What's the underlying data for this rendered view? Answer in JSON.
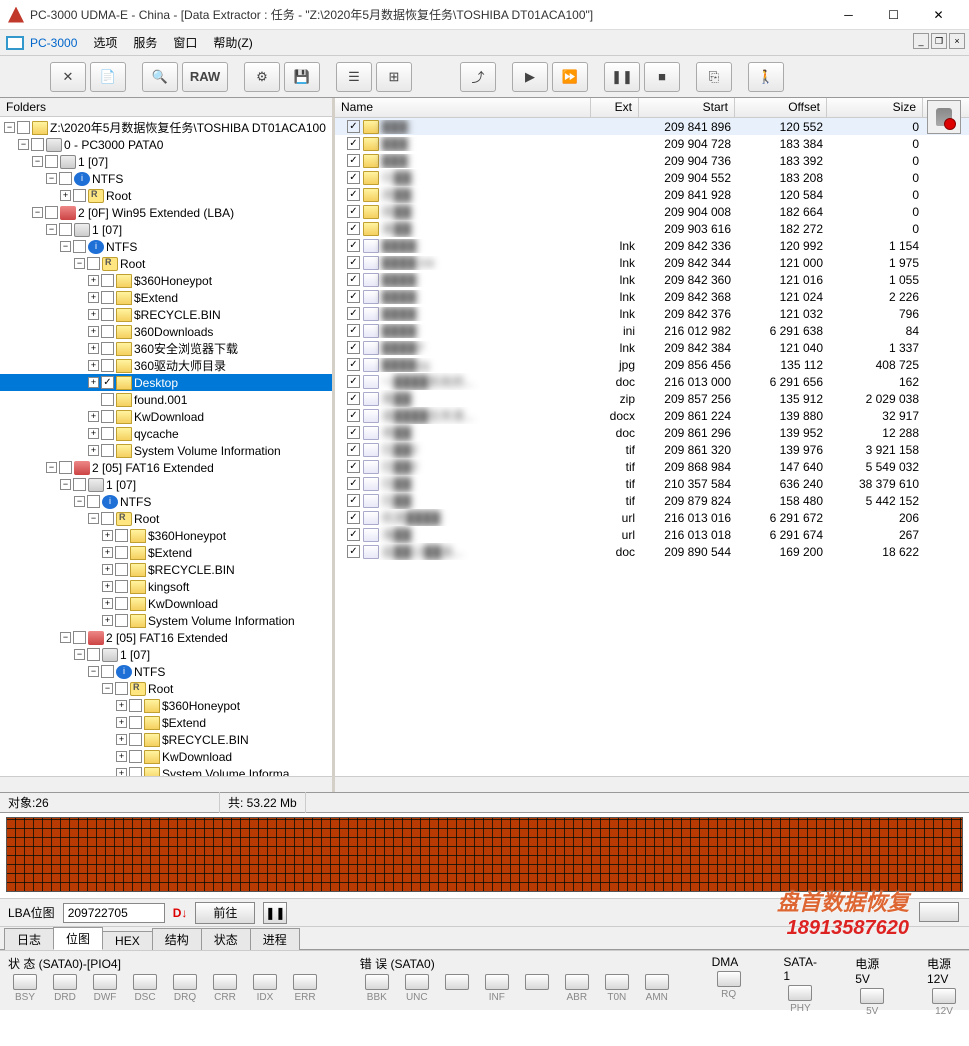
{
  "title": "PC-3000 UDMA-E - China - [Data Extractor : 任务 - \"Z:\\2020年5月数据恢复任务\\TOSHIBA DT01ACA100\"]",
  "menubar": {
    "brand": "PC-3000",
    "items": [
      "选项",
      "服务",
      "窗口",
      "帮助(Z)"
    ]
  },
  "toolbar_raw": "RAW",
  "folders_label": "Folders",
  "tree": [
    {
      "d": 0,
      "ex": "-",
      "ck": "",
      "ic": "folder",
      "t": "Z:\\2020年5月数据恢复任务\\TOSHIBA DT01ACA100"
    },
    {
      "d": 1,
      "ex": "-",
      "ck": "",
      "ic": "drive",
      "t": "0 - PC3000 PATA0"
    },
    {
      "d": 2,
      "ex": "-",
      "ck": "",
      "ic": "drive",
      "t": "1 [07]"
    },
    {
      "d": 3,
      "ex": "-",
      "ck": "",
      "ic": "info",
      "t": "NTFS"
    },
    {
      "d": 4,
      "ex": "+",
      "ck": "",
      "ic": "root",
      "t": "Root"
    },
    {
      "d": 2,
      "ex": "-",
      "ck": "",
      "ic": "part",
      "t": "2 [0F] Win95 Extended  (LBA)"
    },
    {
      "d": 3,
      "ex": "-",
      "ck": "",
      "ic": "drive",
      "t": "1 [07]"
    },
    {
      "d": 4,
      "ex": "-",
      "ck": "",
      "ic": "info",
      "t": "NTFS"
    },
    {
      "d": 5,
      "ex": "-",
      "ck": "",
      "ic": "root",
      "t": "Root"
    },
    {
      "d": 6,
      "ex": "+",
      "ck": "",
      "ic": "folder",
      "t": "$360Honeypot"
    },
    {
      "d": 6,
      "ex": "+",
      "ck": "",
      "ic": "folder",
      "t": "$Extend"
    },
    {
      "d": 6,
      "ex": "+",
      "ck": "",
      "ic": "folder",
      "t": "$RECYCLE.BIN"
    },
    {
      "d": 6,
      "ex": "+",
      "ck": "",
      "ic": "folder",
      "t": "360Downloads"
    },
    {
      "d": 6,
      "ex": "+",
      "ck": "",
      "ic": "folder",
      "t": "360安全浏览器下载"
    },
    {
      "d": 6,
      "ex": "+",
      "ck": "",
      "ic": "folder",
      "t": "360驱动大师目录"
    },
    {
      "d": 6,
      "ex": "+",
      "ck": "✓",
      "ic": "folder",
      "t": "Desktop",
      "sel": true
    },
    {
      "d": 6,
      "ex": "",
      "ck": "",
      "ic": "folder",
      "t": "found.001"
    },
    {
      "d": 6,
      "ex": "+",
      "ck": "",
      "ic": "folder",
      "t": "KwDownload"
    },
    {
      "d": 6,
      "ex": "+",
      "ck": "",
      "ic": "folder",
      "t": "qycache"
    },
    {
      "d": 6,
      "ex": "+",
      "ck": "",
      "ic": "folder",
      "t": "System Volume Information"
    },
    {
      "d": 3,
      "ex": "-",
      "ck": "",
      "ic": "part",
      "t": "2 [05] FAT16 Extended"
    },
    {
      "d": 4,
      "ex": "-",
      "ck": "",
      "ic": "drive",
      "t": "1 [07]"
    },
    {
      "d": 5,
      "ex": "-",
      "ck": "",
      "ic": "info",
      "t": "NTFS"
    },
    {
      "d": 6,
      "ex": "-",
      "ck": "",
      "ic": "root",
      "t": "Root"
    },
    {
      "d": 7,
      "ex": "+",
      "ck": "",
      "ic": "folder",
      "t": "$360Honeypot"
    },
    {
      "d": 7,
      "ex": "+",
      "ck": "",
      "ic": "folder",
      "t": "$Extend"
    },
    {
      "d": 7,
      "ex": "+",
      "ck": "",
      "ic": "folder",
      "t": "$RECYCLE.BIN"
    },
    {
      "d": 7,
      "ex": "+",
      "ck": "",
      "ic": "folder",
      "t": "kingsoft"
    },
    {
      "d": 7,
      "ex": "+",
      "ck": "",
      "ic": "folder",
      "t": "KwDownload"
    },
    {
      "d": 7,
      "ex": "+",
      "ck": "",
      "ic": "folder",
      "t": "System Volume Information"
    },
    {
      "d": 4,
      "ex": "-",
      "ck": "",
      "ic": "part",
      "t": "2 [05] FAT16 Extended"
    },
    {
      "d": 5,
      "ex": "-",
      "ck": "",
      "ic": "drive",
      "t": "1 [07]"
    },
    {
      "d": 6,
      "ex": "-",
      "ck": "",
      "ic": "info",
      "t": "NTFS"
    },
    {
      "d": 7,
      "ex": "-",
      "ck": "",
      "ic": "root",
      "t": "Root"
    },
    {
      "d": 8,
      "ex": "+",
      "ck": "",
      "ic": "folder",
      "t": "$360Honeypot"
    },
    {
      "d": 8,
      "ex": "+",
      "ck": "",
      "ic": "folder",
      "t": "$Extend"
    },
    {
      "d": 8,
      "ex": "+",
      "ck": "",
      "ic": "folder",
      "t": "$RECYCLE.BIN"
    },
    {
      "d": 8,
      "ex": "+",
      "ck": "",
      "ic": "folder",
      "t": "KwDownload"
    },
    {
      "d": 8,
      "ex": "+",
      "ck": "",
      "ic": "folder",
      "t": "System Volume Informa"
    }
  ],
  "cols": {
    "name": "Name",
    "ext": "Ext",
    "start": "Start",
    "offset": "Offset",
    "size": "Size"
  },
  "files": [
    {
      "name": "███",
      "ic": "folder",
      "ext": "",
      "start": "209 841 896",
      "offset": "120 552",
      "size": "0",
      "sel": true
    },
    {
      "name": "███",
      "ic": "folder",
      "ext": "",
      "start": "209 904 728",
      "offset": "183 384",
      "size": "0"
    },
    {
      "name": "███",
      "ic": "folder",
      "ext": "",
      "start": "209 904 736",
      "offset": "183 392",
      "size": "0"
    },
    {
      "name": "仆██",
      "ic": "folder",
      "ext": "",
      "start": "209 904 552",
      "offset": "183 208",
      "size": "0"
    },
    {
      "name": "房██",
      "ic": "folder",
      "ext": "",
      "start": "209 841 928",
      "offset": "120 584",
      "size": "0"
    },
    {
      "name": "拆██",
      "ic": "folder",
      "ext": "",
      "start": "209 904 008",
      "offset": "182 664",
      "size": "0"
    },
    {
      "name": "美██",
      "ic": "folder",
      "ext": "",
      "start": "209 903 616",
      "offset": "182 272",
      "size": "0"
    },
    {
      "name": "████",
      "ic": "file",
      "ext": "lnk",
      "start": "209 842 336",
      "offset": "120 992",
      "size": "1 154"
    },
    {
      "name": "████.lnk",
      "ic": "file",
      "ext": "lnk",
      "start": "209 842 344",
      "offset": "121 000",
      "size": "1 975"
    },
    {
      "name": "████",
      "ic": "file",
      "ext": "lnk",
      "start": "209 842 360",
      "offset": "121 016",
      "size": "1 055"
    },
    {
      "name": "████",
      "ic": "file",
      "ext": "lnk",
      "start": "209 842 368",
      "offset": "121 024",
      "size": "2 226"
    },
    {
      "name": "████",
      "ic": "file",
      "ext": "lnk",
      "start": "209 842 376",
      "offset": "121 032",
      "size": "796"
    },
    {
      "name": "████",
      "ic": "file",
      "ext": "ini",
      "start": "216 012 982",
      "offset": "6 291 638",
      "size": "84"
    },
    {
      "name": "████P",
      "ic": "file",
      "ext": "lnk",
      "start": "209 842 384",
      "offset": "121 040",
      "size": "1 337"
    },
    {
      "name": "████pg",
      "ic": "file",
      "ext": "jpg",
      "start": "209 856 456",
      "offset": "135 112",
      "size": "408 725"
    },
    {
      "name": "～████民政府...",
      "ic": "file",
      "ext": "doc",
      "start": "216 013 000",
      "offset": "6 291 656",
      "size": "162"
    },
    {
      "name": "南██",
      "ic": "file",
      "ext": "zip",
      "start": "209 857 256",
      "offset": "135 912",
      "size": "2 029 038"
    },
    {
      "name": "县████任务清...",
      "ic": "file",
      "ext": "docx",
      "start": "209 861 224",
      "offset": "139 880",
      "size": "32 917"
    },
    {
      "name": "参██",
      "ic": "file",
      "ext": "doc",
      "start": "209 861 296",
      "offset": "139 952",
      "size": "12 288"
    },
    {
      "name": "扫██if",
      "ic": "file",
      "ext": "tif",
      "start": "209 861 320",
      "offset": "139 976",
      "size": "3 921 158"
    },
    {
      "name": "扫██if",
      "ic": "file",
      "ext": "tif",
      "start": "209 868 984",
      "offset": "147 640",
      "size": "5 549 032"
    },
    {
      "name": "扫██",
      "ic": "file",
      "ext": "tif",
      "start": "210 357 584",
      "offset": "636 240",
      "size": "38 379 610"
    },
    {
      "name": "扫██",
      "ic": "file",
      "ext": "tif",
      "start": "209 879 824",
      "offset": "158 480",
      "size": "5 442 152"
    },
    {
      "name": "机类████",
      "ic": "file",
      "ext": "url",
      "start": "216 013 016",
      "offset": "6 291 672",
      "size": "206"
    },
    {
      "name": "海██",
      "ic": "file",
      "ext": "url",
      "start": "216 013 018",
      "offset": "6 291 674",
      "size": "267"
    },
    {
      "name": "盐██13██县...",
      "ic": "file",
      "ext": "doc",
      "start": "209 890 544",
      "offset": "169 200",
      "size": "18 622"
    }
  ],
  "obj": {
    "label": "对象:26",
    "total": "共:   53.22 Mb"
  },
  "lba": {
    "label": "LBA位图",
    "value": "209722705",
    "go": "前往"
  },
  "tabs": [
    "日志",
    "位图",
    "HEX",
    "结构",
    "状态",
    "进程"
  ],
  "active_tab": 1,
  "status": {
    "g1": {
      "lbl": "状 态 (SATA0)-[PIO4]",
      "leds": [
        "BSY",
        "DRD",
        "DWF",
        "DSC",
        "DRQ",
        "CRR",
        "IDX",
        "ERR"
      ]
    },
    "g2": {
      "lbl": "错 误 (SATA0)",
      "leds": [
        "BBK",
        "UNC",
        "",
        "INF",
        "",
        "ABR",
        "T0N",
        "AMN"
      ]
    },
    "g3": {
      "lbl": "DMA",
      "leds": [
        "RQ"
      ]
    },
    "g4": {
      "lbl": "SATA-1",
      "leds": [
        "PHY"
      ]
    },
    "g5": {
      "lbl": "电源 5V",
      "leds": [
        "5V"
      ]
    },
    "g6": {
      "lbl": "电源 12V",
      "leds": [
        "12V"
      ]
    }
  },
  "watermark": {
    "l1": "盘首数据恢复",
    "l2": "18913587620"
  }
}
